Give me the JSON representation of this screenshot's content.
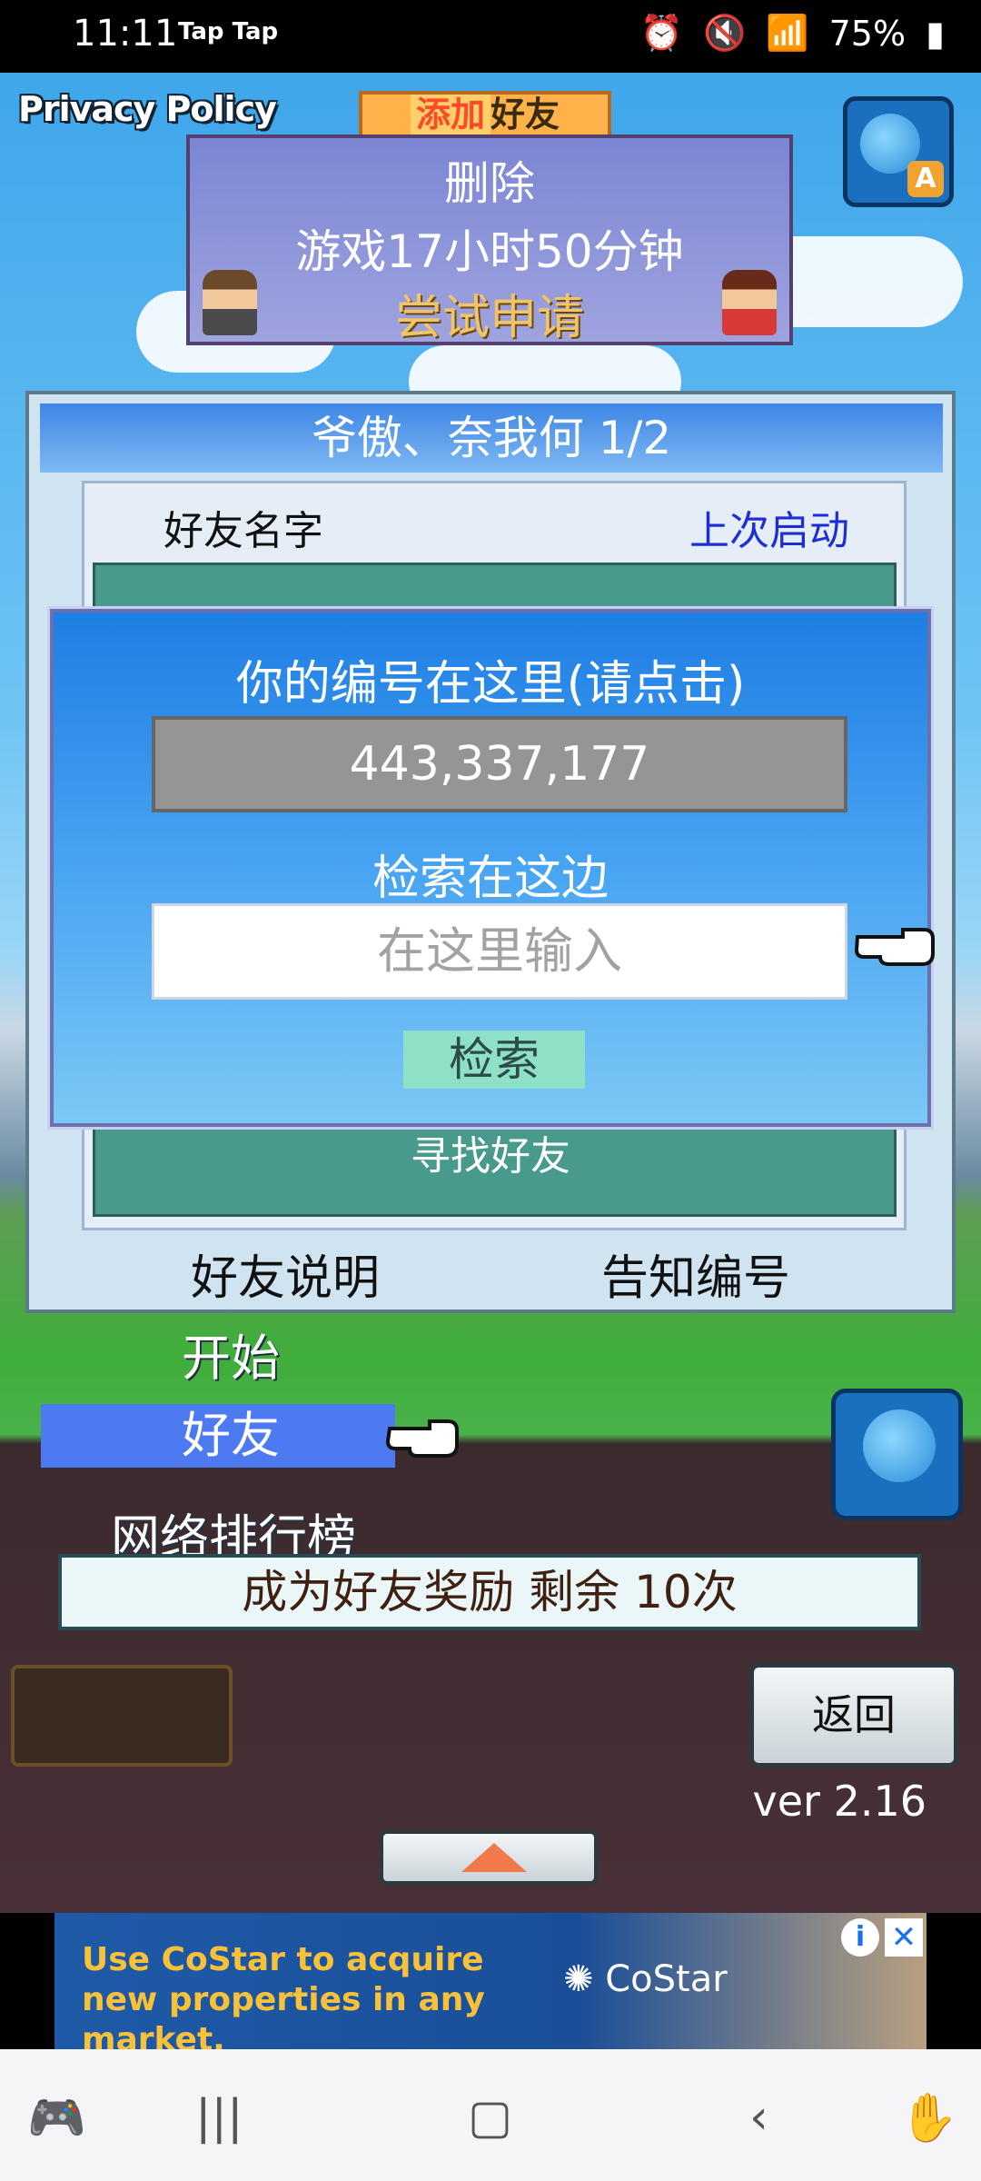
{
  "status_bar": {
    "time": "11:11",
    "app_name": "Tap Tap",
    "battery": "75%"
  },
  "game": {
    "privacy_label": "Privacy Policy",
    "add_friend_tag": {
      "part1": "添加",
      "part2": "好友"
    },
    "top_panel": {
      "line1": "删除",
      "line2": "游戏17小时50分钟",
      "line3": "尝试申请"
    },
    "friends_panel": {
      "title": "爷傲、奈我何 1/2",
      "col_name": "好友名字",
      "col_last": "上次启动",
      "find_friend": "寻找好友",
      "explain_button": "好友说明",
      "notify_button": "告知编号"
    },
    "dialog": {
      "title": "你的编号在这里(请点击)",
      "id_number": "443,337,177",
      "search_label": "检索在这边",
      "search_placeholder": "在这里输入",
      "search_button": "检索"
    },
    "menu": {
      "start": "开始",
      "friend": "好友",
      "ranking": "网络排行榜"
    },
    "reward_bar": "成为好友奖励 剩余 10次",
    "back_button": "返回",
    "version": "ver 2.16"
  },
  "ad": {
    "text": "Use CoStar to acquire new properties in any market.",
    "brand": "CoStar"
  },
  "colors": {
    "dialog_blue": "#1f7ee4",
    "menu_highlight": "#4d7af0",
    "panel_purple": "#7b86d4"
  }
}
